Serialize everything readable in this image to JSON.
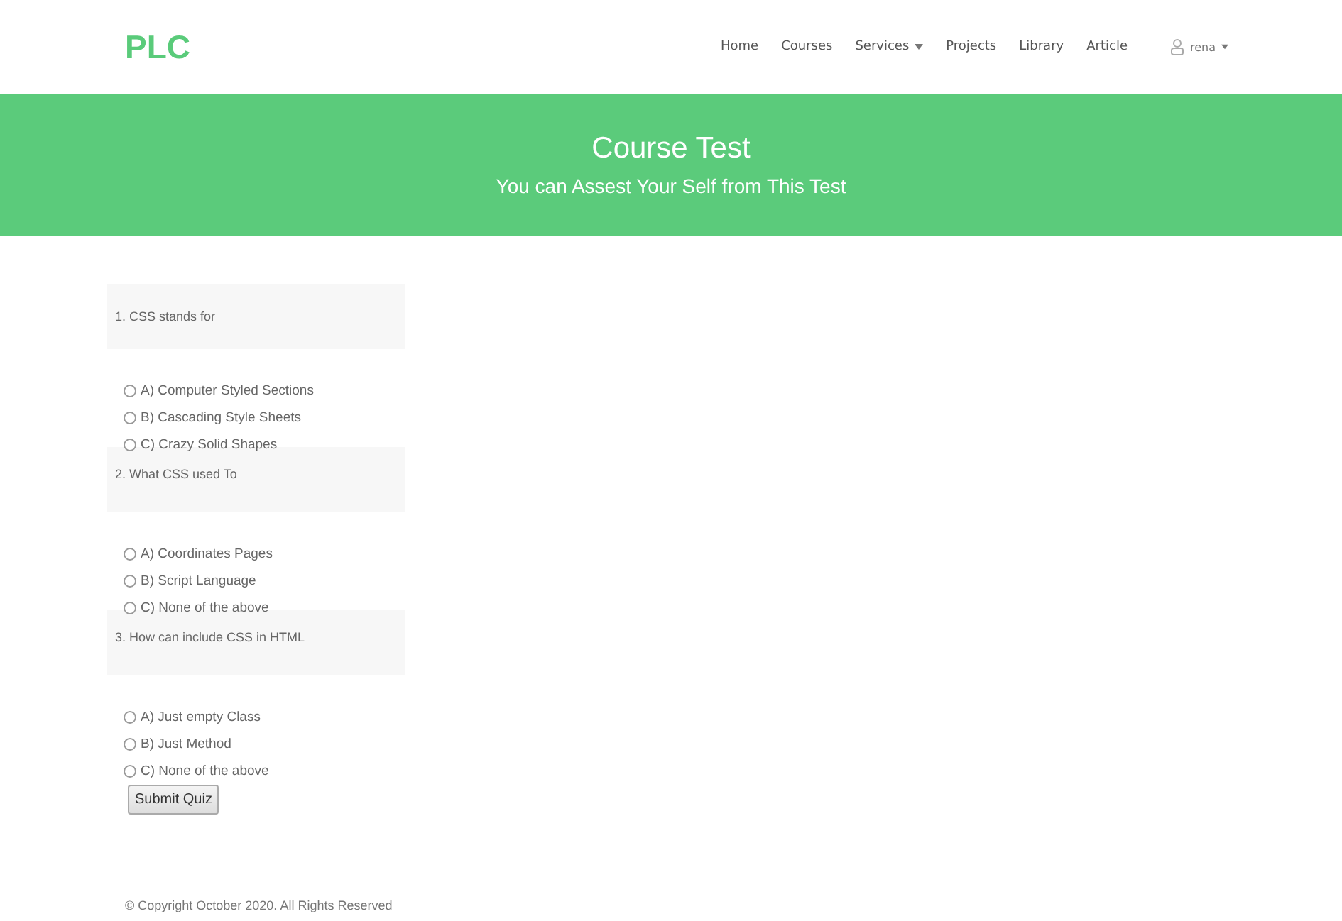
{
  "logo": "PLC",
  "nav": [
    {
      "label": "Home",
      "dropdown": false
    },
    {
      "label": "Courses",
      "dropdown": false
    },
    {
      "label": "Services",
      "dropdown": true
    },
    {
      "label": "Projects",
      "dropdown": false
    },
    {
      "label": "Library",
      "dropdown": false
    },
    {
      "label": "Article",
      "dropdown": false
    }
  ],
  "user": {
    "name": "rena"
  },
  "banner": {
    "title": "Course Test",
    "subtitle": "You can Assest Your Self from This Test"
  },
  "questions": [
    {
      "text": "1. CSS stands for",
      "options": [
        {
          "label": "A) Computer Styled Sections",
          "checked": false
        },
        {
          "label": "B) Cascading Style Sheets",
          "checked": false
        },
        {
          "label": "C) Crazy Solid Shapes",
          "checked": false
        }
      ]
    },
    {
      "text": "2. What CSS used To",
      "options": [
        {
          "label": "A) Coordinates Pages",
          "checked": false
        },
        {
          "label": "B) Script Language",
          "checked": false
        },
        {
          "label": "C) None of the above",
          "checked": false
        }
      ]
    },
    {
      "text": "3. How can include CSS in HTML",
      "options": [
        {
          "label": "A) Just empty Class",
          "checked": false
        },
        {
          "label": "B) Just Method",
          "checked": false
        },
        {
          "label": "C) None of the above",
          "checked": false
        }
      ]
    }
  ],
  "submit": "Submit Quiz",
  "footer": "© Copyright October 2020. All Rights Reserved"
}
